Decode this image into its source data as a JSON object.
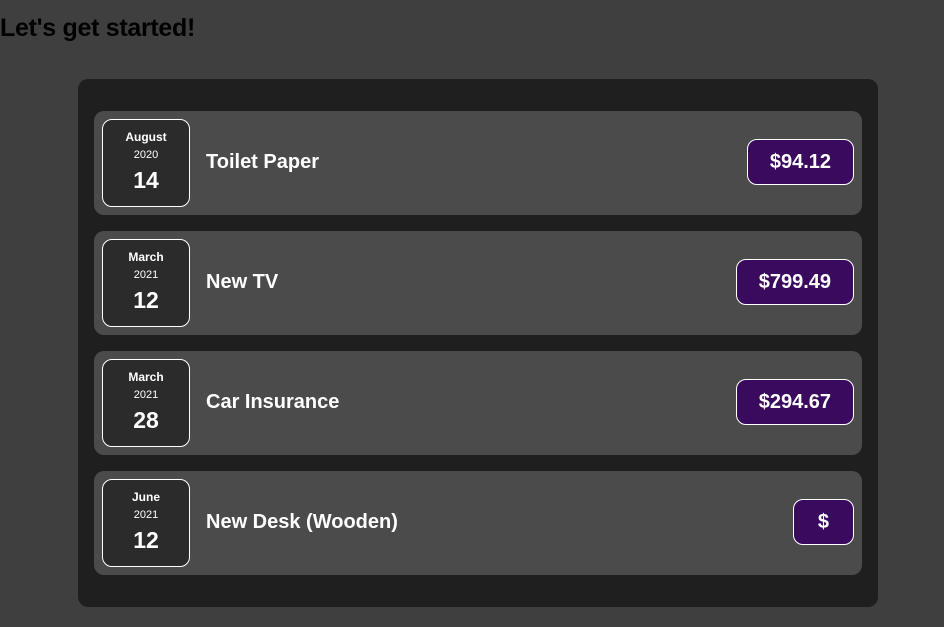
{
  "page": {
    "title": "Let's get started!"
  },
  "colors": {
    "background": "#3f3f3f",
    "panel": "#1f1f1f",
    "item": "#4b4b4b",
    "price_badge": "#3a0a5e",
    "text": "#ffffff"
  },
  "expenses": [
    {
      "month": "August",
      "year": "2020",
      "day": "14",
      "title": "Toilet Paper",
      "amount": "$94.12"
    },
    {
      "month": "March",
      "year": "2021",
      "day": "12",
      "title": "New TV",
      "amount": "$799.49"
    },
    {
      "month": "March",
      "year": "2021",
      "day": "28",
      "title": "Car Insurance",
      "amount": "$294.67"
    },
    {
      "month": "June",
      "year": "2021",
      "day": "12",
      "title": "New Desk (Wooden)",
      "amount": "$"
    }
  ]
}
